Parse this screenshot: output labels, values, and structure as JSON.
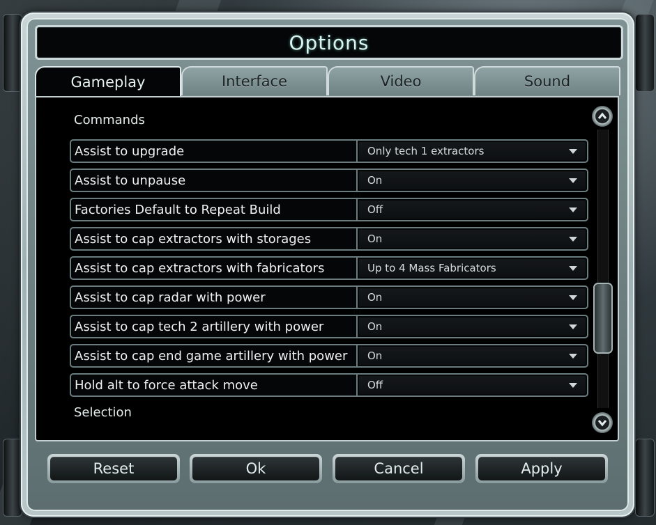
{
  "window": {
    "title": "Options"
  },
  "tabs": [
    {
      "label": "Gameplay",
      "active": true
    },
    {
      "label": "Interface",
      "active": false
    },
    {
      "label": "Video",
      "active": false
    },
    {
      "label": "Sound",
      "active": false
    }
  ],
  "sections": {
    "commands": "Commands",
    "selection": "Selection"
  },
  "settings": [
    {
      "label": "Assist to upgrade",
      "value": "Only tech 1 extractors"
    },
    {
      "label": "Assist to unpause",
      "value": "On"
    },
    {
      "label": "Factories Default to Repeat Build",
      "value": "Off"
    },
    {
      "label": "Assist to cap extractors with storages",
      "value": "On"
    },
    {
      "label": "Assist to cap extractors with fabricators",
      "value": "Up to 4 Mass Fabricators"
    },
    {
      "label": "Assist to cap radar with power",
      "value": "On"
    },
    {
      "label": "Assist to cap tech 2 artillery with power",
      "value": "On"
    },
    {
      "label": "Assist to cap end game artillery with power",
      "value": "On"
    },
    {
      "label": "Hold alt to force attack move",
      "value": "Off"
    }
  ],
  "buttons": {
    "reset": "Reset",
    "ok": "Ok",
    "cancel": "Cancel",
    "apply": "Apply"
  },
  "icons": {
    "scroll_up": "chevron-up-icon",
    "scroll_down": "chevron-down-icon",
    "dropdown": "caret-down-icon"
  },
  "colors": {
    "title_text": "#d8f3f0",
    "panel_bg": "#000000",
    "frame": "#c9d5d6"
  }
}
